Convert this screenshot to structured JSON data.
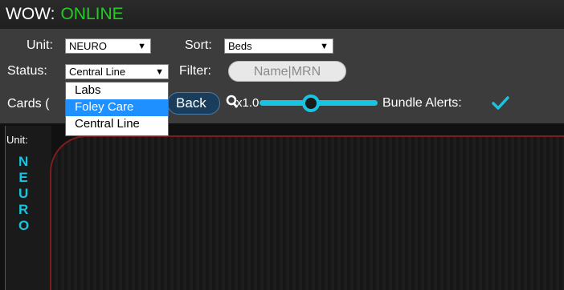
{
  "header": {
    "app_name": "WOW:",
    "status": "ONLINE"
  },
  "controls": {
    "unit_label": "Unit:",
    "unit_value": "NEURO",
    "sort_label": "Sort:",
    "sort_value": "Beds",
    "status_label": "Status:",
    "status_value": "Central Line",
    "filter_label": "Filter:",
    "filter_placeholder": "Name|MRN",
    "cards_label": "Cards (",
    "back_label": "Back",
    "zoom_value": "x1.0",
    "bundle_alerts_label": "Bundle Alerts:",
    "bundle_alerts_checked": true
  },
  "status_dropdown": {
    "options": [
      "Labs",
      "Foley Care",
      "Central Line"
    ],
    "highlighted": "Foley Care"
  },
  "panel": {
    "unit_caption": "Unit:",
    "unit_letters": [
      "N",
      "E",
      "U",
      "R",
      "O"
    ]
  },
  "colors": {
    "accent": "#19c4e0",
    "online": "#22cc22",
    "card_border": "#7d1d1d"
  }
}
